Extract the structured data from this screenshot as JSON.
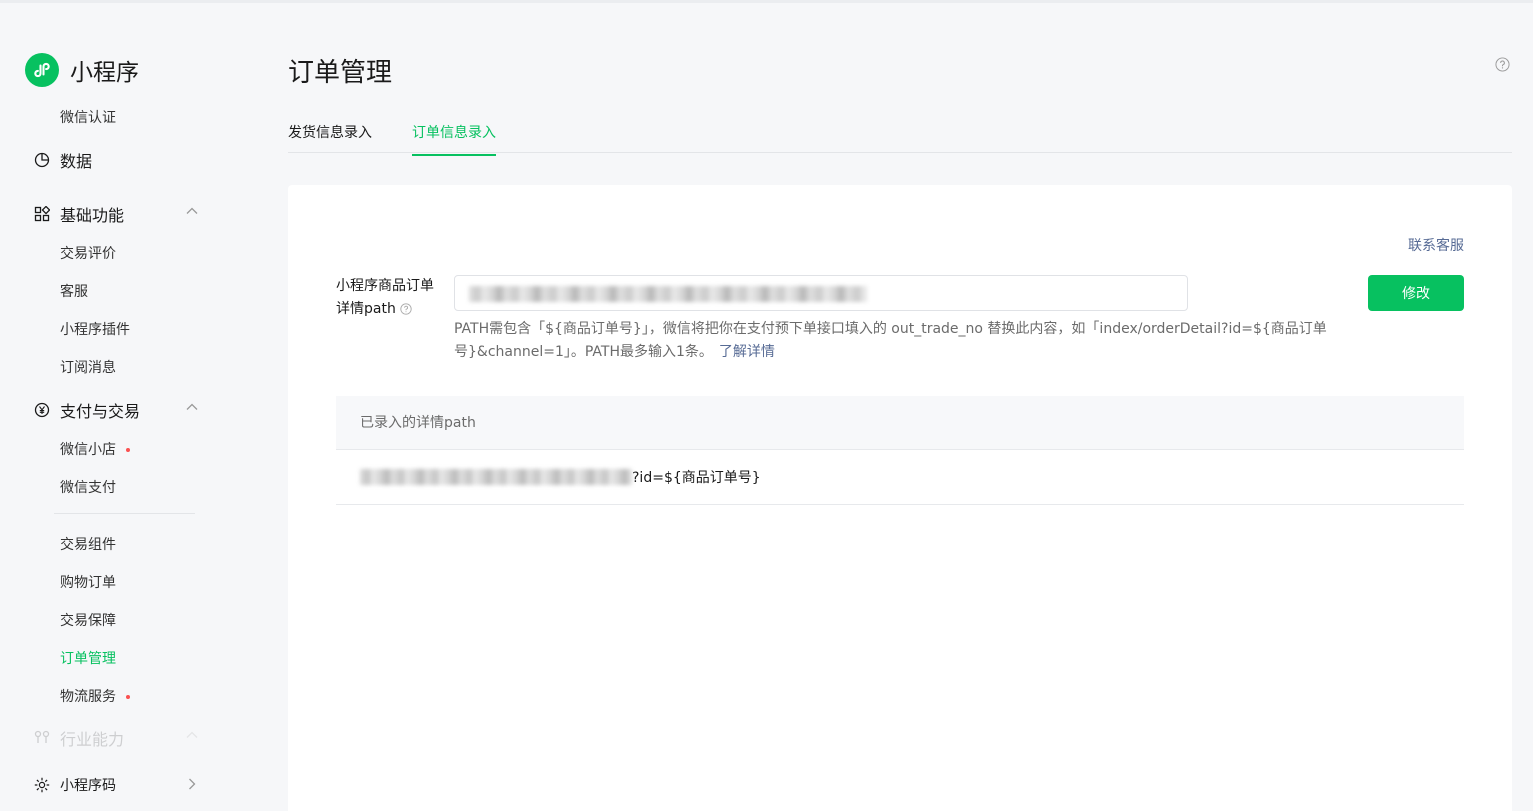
{
  "app": {
    "name": "小程序"
  },
  "sidebar": {
    "top_sub": "微信认证",
    "data_label": "数据",
    "basic": {
      "label": "基础功能",
      "items": [
        "交易评价",
        "客服",
        "小程序插件",
        "订阅消息"
      ]
    },
    "pay": {
      "label": "支付与交易",
      "items": [
        "微信小店",
        "微信支付"
      ],
      "items2": [
        "交易组件",
        "购物订单",
        "交易保障",
        "订单管理",
        "物流服务"
      ]
    },
    "industry_label": "行业能力",
    "code_label": "小程序码"
  },
  "page": {
    "title": "订单管理",
    "tabs": [
      "发货信息录入",
      "订单信息录入"
    ],
    "contact": "联系客服",
    "field_label": "小程序商品订单详情path",
    "modify": "修改",
    "hint": "PATH需包含「${商品订单号}」，微信将把你在支付预下单接口填入的 out_trade_no 替换此内容，如「index/orderDetail?id=${商品订单号}&channel=1」。PATH最多输入1条。",
    "hint_link": "了解详情",
    "table": {
      "header": "已录入的详情path",
      "row_suffix": "?id=${商品订单号}"
    }
  },
  "colors": {
    "brand": "#07c160",
    "link": "#576b95",
    "badge": "#fa5151"
  }
}
